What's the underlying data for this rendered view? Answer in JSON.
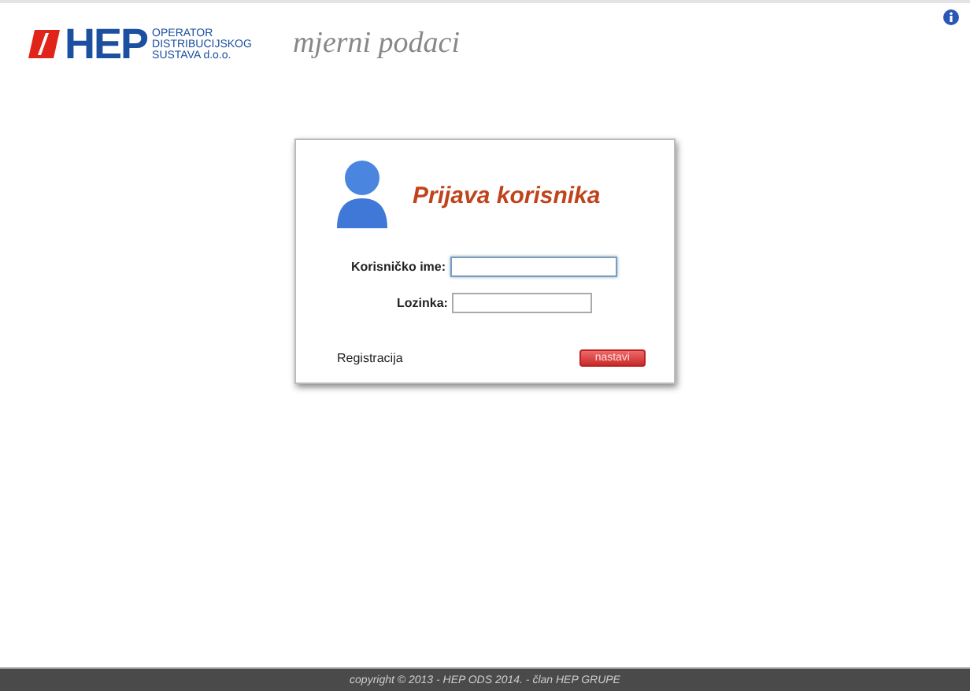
{
  "header": {
    "logo": {
      "brand": "HEP",
      "lines": [
        "OPERATOR",
        "DISTRIBUCIJSKOG",
        "SUSTAVA d.o.o."
      ]
    },
    "title": "mjerni podaci"
  },
  "login": {
    "title": "Prijava korisnika",
    "fields": [
      {
        "label": "Korisničko ime:",
        "focused": true
      },
      {
        "label": "Lozinka:",
        "focused": false
      }
    ],
    "register_link": "Registracija",
    "submit": "nastavi"
  },
  "footer": "copyright © 2013 - HEP ODS 2014. - član HEP GRUPE"
}
